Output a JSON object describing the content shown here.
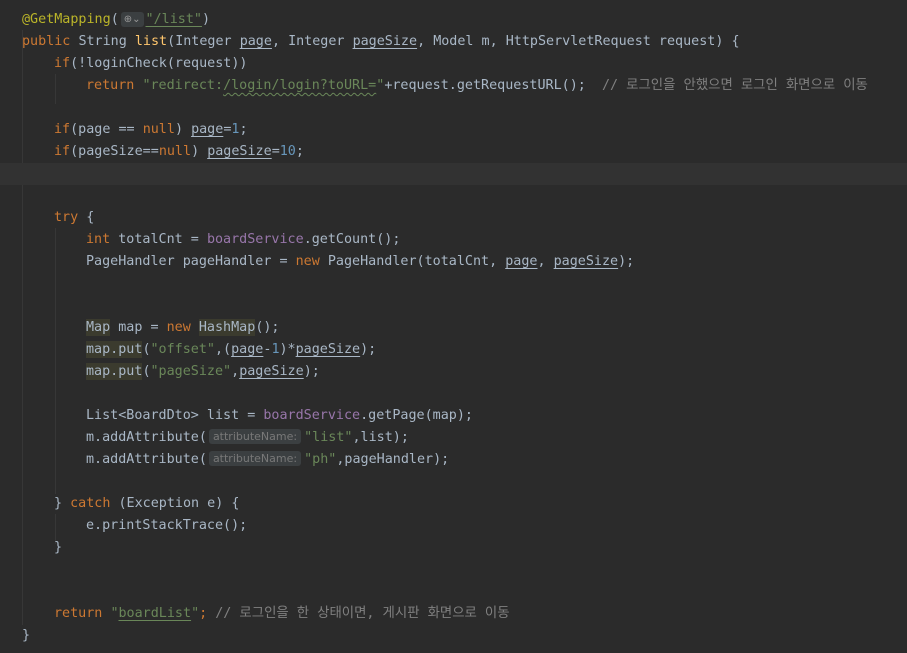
{
  "code": {
    "annotation_name": "@GetMapping",
    "web_icon": "globe-chevron-icon",
    "mapping_path": "\"/list\"",
    "sig_public": "public",
    "sig_return": "String",
    "sig_method": "list",
    "sig_p_type1": "Integer",
    "sig_p1": "page",
    "sig_p_type2": "Integer",
    "sig_p2": "pageSize",
    "sig_rest": "Model m, HttpServletRequest request) {",
    "if1": "if",
    "if1_cond": "(!loginCheck(request))",
    "return1": "return",
    "redirect_a": "\"redirect:",
    "redirect_b": "/login/login?toURL=",
    "redirect_c": "\"",
    "return1_tail": "+request.getRequestURL();",
    "comment1": "// 로그인을 안했으면 로그인 화면으로 이동",
    "if2": "if",
    "null_kw": "null",
    "one": "1",
    "ten": "10",
    "try_kw": "try",
    "int_kw": "int",
    "totalcnt_decl": "totalCnt = ",
    "board_service": "boardService",
    "get_count": ".getCount();",
    "page_handler_decl": "PageHandler pageHandler = ",
    "new_kw": "new",
    "page_handler_ctor": " PageHandler(totalCnt, ",
    "map_type": "Map",
    "map_decl": " map = ",
    "hashmap": "HashMap",
    "map_put": "map.put",
    "offset_str": "\"offset\"",
    "pagesize_str": "\"pageSize\"",
    "list_decl": "List<BoardDto> list = ",
    "get_page": ".getPage(map);",
    "add_attr": "m.addAttribute(",
    "param_hint": "attributeName:",
    "list_str": "\"list\"",
    "list_tail": ",list);",
    "ph_str": "\"ph\"",
    "ph_tail": ",pageHandler);",
    "catch_kw": "catch",
    "exception": " (Exception e) {",
    "stack_trace": "e.printStackTrace();",
    "return2": "return",
    "board_list": "boardList",
    "comment2": "// 로그인을 한 상태이면, 게시판 화면으로 이동"
  },
  "colors": {
    "background": "#2b2b2b",
    "keyword": "#cc7832",
    "string": "#6a8759",
    "number": "#6897bb",
    "field": "#9876aa",
    "method": "#ffc66d",
    "annotation": "#bbb529",
    "comment": "#808080"
  }
}
